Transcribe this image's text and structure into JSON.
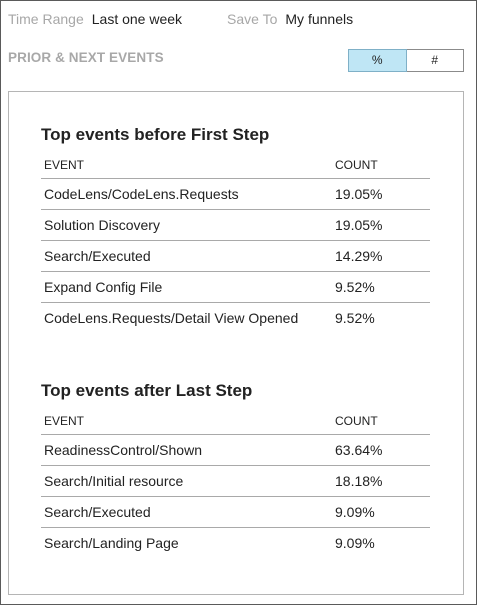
{
  "toolbar": {
    "time_range_label": "Time Range",
    "time_range_value": "Last one week",
    "save_to_label": "Save To",
    "save_to_value": "My funnels"
  },
  "section_title": "PRIOR & NEXT EVENTS",
  "toggle": {
    "percent_label": "%",
    "count_label": "#",
    "selected": "%"
  },
  "before": {
    "title": "Top events before First Step",
    "col_event": "EVENT",
    "col_count": "COUNT",
    "rows": [
      {
        "event": "CodeLens/CodeLens.Requests",
        "count": "19.05%"
      },
      {
        "event": "Solution Discovery",
        "count": "19.05%"
      },
      {
        "event": "Search/Executed",
        "count": "14.29%"
      },
      {
        "event": "Expand Config File",
        "count": "9.52%"
      },
      {
        "event": "CodeLens.Requests/Detail View Opened",
        "count": "9.52%"
      }
    ]
  },
  "after": {
    "title": "Top events after Last Step",
    "col_event": "EVENT",
    "col_count": "COUNT",
    "rows": [
      {
        "event": "ReadinessControl/Shown",
        "count": "63.64%"
      },
      {
        "event": "Search/Initial resource",
        "count": "18.18%"
      },
      {
        "event": "Search/Executed",
        "count": "9.09%"
      },
      {
        "event": "Search/Landing Page",
        "count": "9.09%"
      }
    ]
  },
  "colors": {
    "toggle_active_bg": "#bfe6f5",
    "muted_label": "#a7a7a7"
  }
}
